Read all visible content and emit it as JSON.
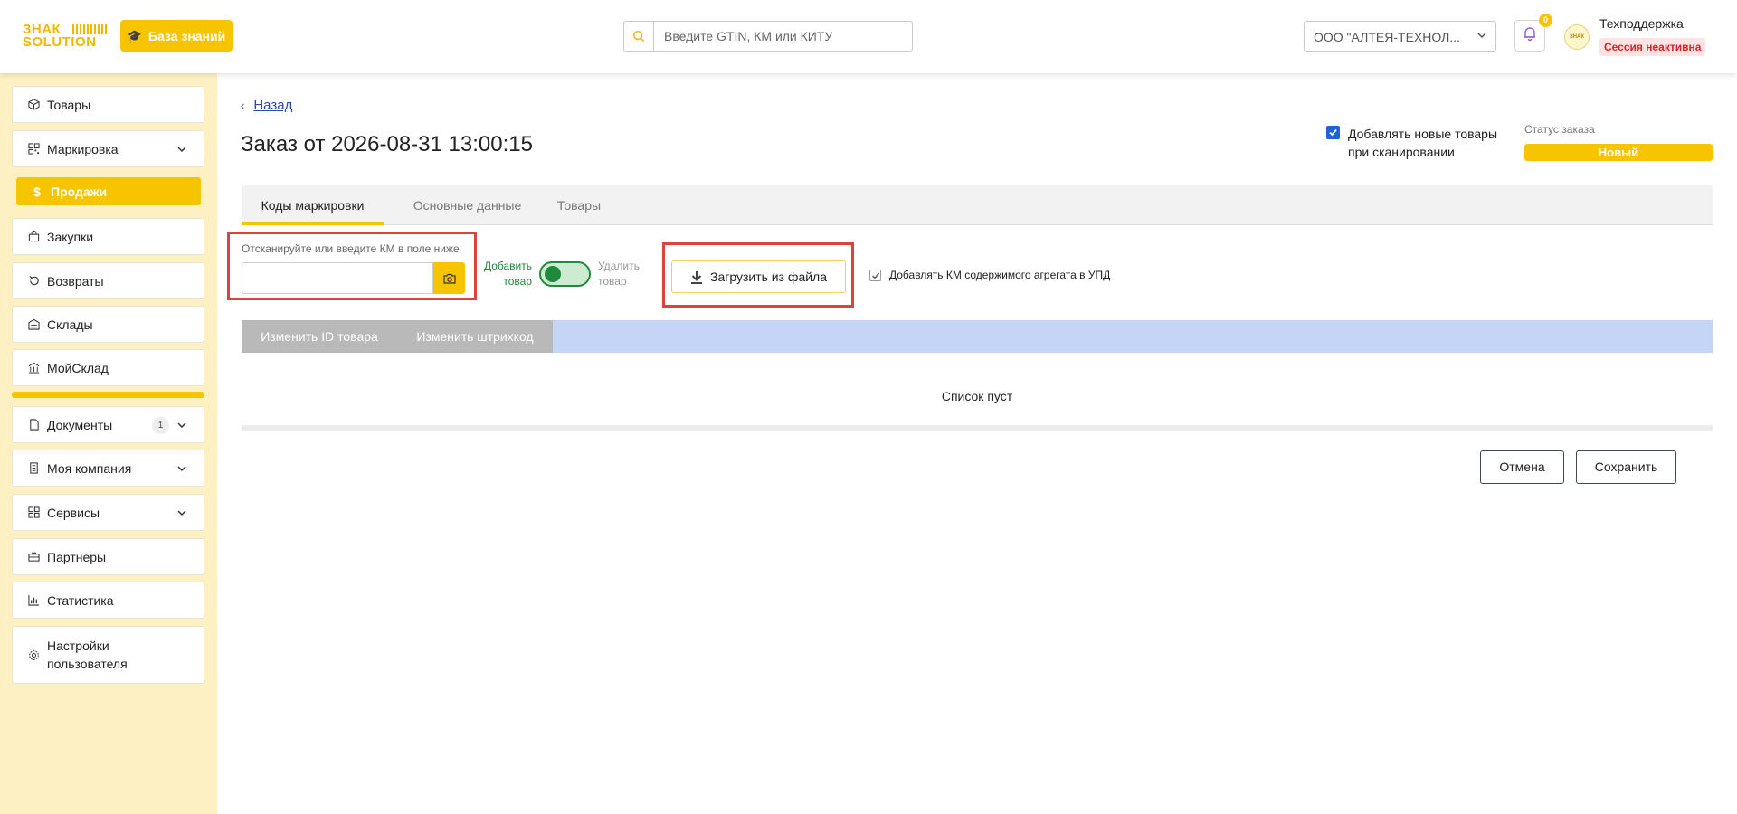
{
  "header": {
    "logo_line1": "ЗНАК",
    "logo_line2": "SOLUTION",
    "knowledge_base_label": "База знаний",
    "search_placeholder": "Введите GTIN, КМ или КИТУ",
    "org_selected": "ООО \"АЛТЕЯ-ТЕХНОЛ...",
    "notifications_count": "0",
    "avatar_text": "ЗНАК",
    "user_name": "Техподдержка",
    "session_status": "Сессия неактивна"
  },
  "sidebar": {
    "items": [
      {
        "label": "Товары",
        "icon": "box-icon"
      },
      {
        "label": "Маркировка",
        "icon": "qr-icon"
      },
      {
        "label": "Продажи",
        "icon": "dollar-icon"
      },
      {
        "label": "Закупки",
        "icon": "bag-icon"
      },
      {
        "label": "Возвраты",
        "icon": "return-icon"
      },
      {
        "label": "Склады",
        "icon": "warehouse-icon"
      },
      {
        "label": "МойСклад",
        "icon": "building-icon"
      },
      {
        "label": "Документы",
        "icon": "document-icon",
        "count": "1"
      },
      {
        "label": "Моя компания",
        "icon": "company-icon"
      },
      {
        "label": "Сервисы",
        "icon": "grid-icon"
      },
      {
        "label": "Партнеры",
        "icon": "briefcase-icon"
      },
      {
        "label": "Статистика",
        "icon": "chart-icon"
      },
      {
        "label": "Настройки пользователя",
        "icon": "gear-icon"
      }
    ],
    "active_item": "Продажи"
  },
  "main": {
    "back_label": "Назад",
    "title": "Заказ от 2026-08-31 13:00:15",
    "add_new_on_scan_label": "Добавлять новые товары при сканировании",
    "add_new_on_scan_checked": true,
    "status_label": "Статус заказа",
    "status_value": "Новый",
    "tabs": [
      {
        "label": "Коды маркировки",
        "active": true
      },
      {
        "label": "Основные данные",
        "active": false
      },
      {
        "label": "Товары",
        "active": false
      }
    ],
    "scan_label": "Отсканируйте или введите КМ в поле ниже",
    "scan_value": "",
    "toggle_add_label": "Добавить товар",
    "toggle_remove_label": "Удалить товар",
    "toggle_state": "add",
    "upload_label": "Загрузить из файла",
    "aggregate_label": "Добавлять КМ содержимого агрегата в УПД",
    "aggregate_checked": true,
    "action_buttons": [
      "Изменить ID товара",
      "Изменить штрихкод"
    ],
    "empty_text": "Список пуст",
    "cancel_label": "Отмена",
    "save_label": "Сохранить"
  },
  "colors": {
    "accent": "#f7c400",
    "sidebar_bg": "#fdf1c4",
    "link": "#2b4aa6",
    "highlight_box": "#d9443f",
    "toggle_green": "#1f8a3b",
    "action_bar": "#c5d5f8",
    "session_badge_text": "#d0272c"
  }
}
